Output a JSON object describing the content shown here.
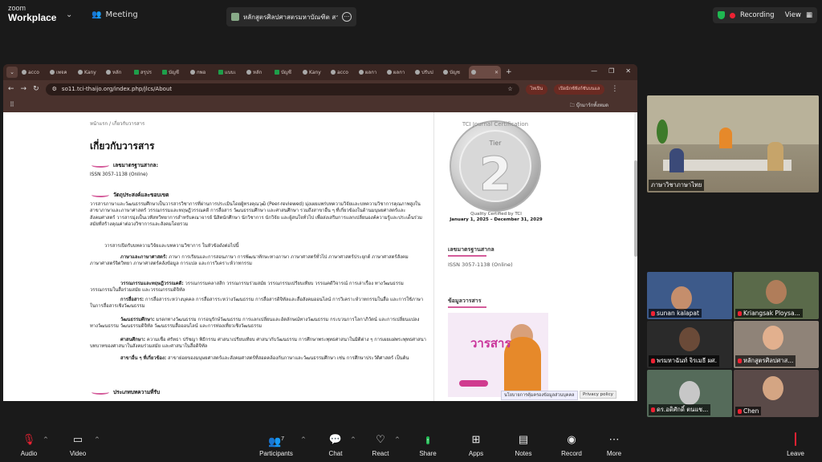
{
  "zoom": {
    "logo_line1": "zoom",
    "logo_line2": "Workplace",
    "meeting_label": "Meeting",
    "share_title": "หลักสูตรศิลปศาสตรมหาบัณฑิต สาขาวิ",
    "recording_label": "Recording",
    "view_label": "View"
  },
  "browser": {
    "tabs": [
      {
        "label": "acco",
        "type": "normal"
      },
      {
        "label": "เพจค",
        "type": "normal"
      },
      {
        "label": "Kany",
        "type": "normal"
      },
      {
        "label": "หลัก",
        "type": "normal"
      },
      {
        "label": "สรุปร",
        "type": "green"
      },
      {
        "label": "บัญชี",
        "type": "green"
      },
      {
        "label": "กพอ",
        "type": "normal"
      },
      {
        "label": "แบบเ",
        "type": "green"
      },
      {
        "label": "หลัก",
        "type": "normal"
      },
      {
        "label": "บัญชี",
        "type": "green"
      },
      {
        "label": "Kany",
        "type": "normal"
      },
      {
        "label": "acco",
        "type": "normal"
      },
      {
        "label": "ผลกา",
        "type": "normal"
      },
      {
        "label": "ผลกา",
        "type": "normal"
      },
      {
        "label": "ปรับป",
        "type": "normal"
      },
      {
        "label": "บัญช",
        "type": "normal"
      },
      {
        "label": "",
        "type": "active"
      }
    ],
    "url": "so11.tci-thaijo.org/index.php/jlcs/About",
    "reading_mode_label": "ไทเปิน",
    "action_label": "เปิดมิกซ์ฟังก์ชันบนแล",
    "bookmarks_all": "บุ๊กมาร์กทั้งหมด"
  },
  "page": {
    "breadcrumb": "หน้าแรก / เกี่ยวกับวารสาร",
    "title": "เกี่ยวกับวารสาร",
    "issn_heading": "เลขมาตรฐานสากล:",
    "issn_value": "ISSN 3057-1138 (Online)",
    "aims_heading": "วัตถุประสงค์และขอบเขต",
    "aims_p1": "วารสารภาษาและวัฒนธรรมศึกษาเป็นวารสารวิชาการที่ผ่านการประเมินโดยผู้ทรงคุณวุฒิ (Peer-reviewed) มุ่งเผยแพร่บทความวิจัยและบทความวิชาการคุณภาพสูงในสาขาภาษาและภาษาศาสตร์ วรรณกรรมและทฤษฎีวรรณคดี การสื่อสาร วัฒนธรรมศึกษา และศาสนศึกษา รวมถึงสาขาอื่น ๆ ที่เกี่ยวข้องในด้านมนุษยศาสตร์และสังคมศาสตร์ วารสารมุ่งเป็นเวทีสหวิทยาการสำหรับคณาจารย์ นิสิตนักศึกษา นักวิชาการ นักวิจัย และผู้สนใจทั่วไป เพื่อส่งเสริมการแลกเปลี่ยนองค์ความรู้และประเด็นร่วมสมัยที่สร้างคุณค่าต่อวงวิชาการและสังคมโดยรวม",
    "aims_p2": "วารสารเปิดรับบทความวิจัยและบทความวิชาการ ในหัวข้อดังต่อไปนี้",
    "topics": [
      {
        "label": "ภาษาและภาษาศาสตร์:",
        "text": "ภาษา การเรียนและการสอนภาษา การพัฒนาทักษะทางภาษา ภาษาศาสตร์ทั่วไป ภาษาศาสตร์ประยุกต์ ภาษาศาสตร์สังคม ภาษาศาสตร์จิตวิทยา ภาษาศาสตร์คลังข้อมูล การแปล และการวิเคราะห์วาทกรรม"
      },
      {
        "label": "วรรณกรรมและทฤษฎีวรรณคดี:",
        "text": "วรรณกรรมคลาสสิก วรรณกรรมร่วมสมัย วรรณกรรมเปรียบเทียบ วรรณคดีวิจารณ์ การเล่าเรื่อง ทางวัฒนธรรม วรรณกรรมในสื่อร่วมสมัย และวรรณกรรมดิจิทัล"
      },
      {
        "label": "การสื่อสาร:",
        "text": "การสื่อสารระหว่างบุคคล การสื่อสารระหว่างวัฒนธรรม การสื่อสารดิจิทัลและสื่อสังคมออนไลน์ การวิเคราะห์วาทกรรมในสื่อ และการใช้ภาษาในการสื่อสารเชิงวัฒนธรรม"
      },
      {
        "label": "วัฒนธรรมศึกษา:",
        "text": "มรดกทางวัฒนธรรม การอนุรักษ์วัฒนธรรม การแลกเปลี่ยนและอัตลักษณ์ทางวัฒนธรรม กระบวนการโลกาภิวัตน์ และการเปลี่ยนแปลงทางวัฒนธรรม วัฒนธรรมดิจิทัล วัฒนธรรมสื่อออนไลน์ และการท่องเที่ยวเชิงวัฒนธรรม"
      },
      {
        "label": "ศาสนศึกษา:",
        "text": "ความเชื่อ ศรัทธา ปรัชญา พิธีกรรม ศาสนาเปรียบเทียบ ศาสนากับวัฒนธรรม การศึกษาพระพุทธศาสนาในมิติต่าง ๆ การเผยแผ่พระพุทธศาสนา บทบาทของศาสนาในสังคมร่วมสมัย และศาสนาในสื่อดิจิทัล"
      },
      {
        "label": "สาขาอื่น ๆ ที่เกี่ยวข้อง:",
        "text": "สาขาย่อยของมนุษยศาสตร์และสังคมศาสตร์ที่สอดคล้องกับภาษาและวัฒนธรรมศึกษา เช่น การศึกษาประวัติศาสตร์ เป็นต้น"
      }
    ],
    "types_heading": "ประเภทบทความที่รับ",
    "medal_top": "TCI Journal Certification",
    "medal_tier": "Tier",
    "medal_number": "2",
    "medal_caption": "Quality Certified by TCI",
    "medal_dates": "January 1, 2025 – December 31, 2029",
    "side_issn_heading": "เลขมาตรฐานสากล",
    "side_issn_value": "ISSN 3057-1138 (Online)",
    "side_journal_heading": "ข้อมูลวารสาร",
    "cover_title": "วารสาร",
    "cookie_label": "นโยบายการคุ้มครองข้อมูลส่วนบุคคล",
    "privacy_label": "Privacy policy"
  },
  "participants": [
    {
      "name": "ภาษาวิชาภาษาไทย",
      "muted": false
    },
    {
      "name": "sunan kalapat",
      "muted": true
    },
    {
      "name": "Kriangsak Ploysa...",
      "muted": true
    },
    {
      "name": "พรมหาฉันท์ จิรเมธี ผศ.",
      "muted": true
    },
    {
      "name": "หลักสูตรศิลปศาส...",
      "muted": true
    },
    {
      "name": "ดร.อดิศักดิ์ ตนแช...",
      "muted": true
    },
    {
      "name": "Chen",
      "muted": true
    }
  ],
  "toolbar": {
    "audio": "Audio",
    "video": "Video",
    "participants": "Participants",
    "participants_count": "7",
    "chat": "Chat",
    "react": "React",
    "share": "Share",
    "apps": "Apps",
    "notes": "Notes",
    "record": "Record",
    "more": "More",
    "leave": "Leave"
  },
  "colors": {
    "zoom_bg": "#1a1a1a",
    "browser_frame": "#3c2a26",
    "accent_pink": "#d45b9a",
    "share_green": "#1fb851",
    "record_red": "#e22233"
  }
}
